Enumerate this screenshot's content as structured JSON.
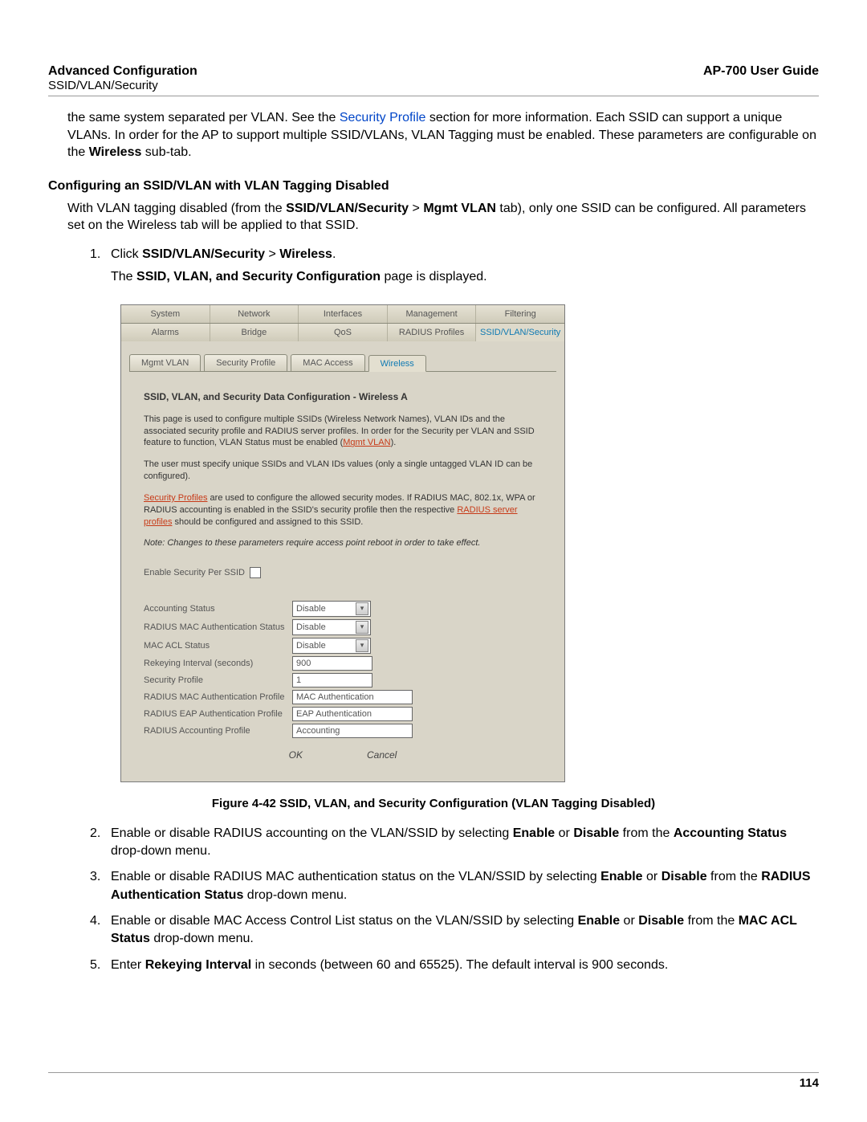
{
  "header": {
    "title": "Advanced Configuration",
    "subtitle": "SSID/VLAN/Security",
    "guide": "AP-700 User Guide"
  },
  "intro": {
    "p1a": "the same system separated per VLAN. See the ",
    "p1_link": "Security Profile",
    "p1b": " section for more information. Each SSID can support a unique VLANs. In order for the AP to support multiple SSID/VLANs, VLAN Tagging must be enabled. These parameters are configurable on the ",
    "p1_bold": "Wireless",
    "p1c": " sub-tab."
  },
  "section1": {
    "heading": "Configuring an SSID/VLAN with VLAN Tagging Disabled",
    "p1a": "With VLAN tagging disabled (from the ",
    "p1_bold1": "SSID/VLAN/Security",
    "p1_gt1": " > ",
    "p1_bold2": "Mgmt VLAN",
    "p1b": " tab), only one SSID can be configured. All parameters set on the Wireless tab will be applied to that SSID."
  },
  "step1": {
    "num": "1.",
    "a": "Click ",
    "b1": "SSID/VLAN/Security",
    "gt": " > ",
    "b2": "Wireless",
    "c": ".",
    "line2a": "The ",
    "line2b": "SSID, VLAN, and Security Configuration",
    "line2c": " page is displayed."
  },
  "shot": {
    "tabs1": [
      "System",
      "Network",
      "Interfaces",
      "Management",
      "Filtering"
    ],
    "tabs2": [
      "Alarms",
      "Bridge",
      "QoS",
      "RADIUS Profiles",
      "SSID/VLAN/Security"
    ],
    "subtabs": [
      "Mgmt VLAN",
      "Security Profile",
      "MAC Access",
      "Wireless"
    ],
    "active_tab2": 4,
    "active_subtab": 3,
    "title": "SSID, VLAN, and Security Data Configuration - Wireless A",
    "p1": "This page is used to configure multiple SSIDs (Wireless Network Names), VLAN IDs and the associated security profile and RADIUS server profiles. In order for the Security per VLAN and SSID feature to function, VLAN Status must be enabled (",
    "p1_link": "Mgmt VLAN",
    "p1_end": ").",
    "p2": "The user must specify unique SSIDs and VLAN IDs values (only a single untagged VLAN ID can be configured).",
    "p3_link": "Security Profiles",
    "p3": " are used to configure the allowed security modes. If RADIUS MAC, 802.1x, WPA or RADIUS accounting is enabled in the SSID's security profile then the respective ",
    "p3_link2": "RADIUS server profiles",
    "p3_end": " should be configured and assigned to this SSID.",
    "note": "Note: Changes to these parameters require access point reboot in order to take effect.",
    "chk_label": "Enable Security Per SSID",
    "rows": [
      {
        "label": "Accounting Status",
        "type": "select",
        "value": "Disable"
      },
      {
        "label": "RADIUS MAC Authentication Status",
        "type": "select",
        "value": "Disable"
      },
      {
        "label": "MAC ACL Status",
        "type": "select",
        "value": "Disable"
      },
      {
        "label": "Rekeying Interval (seconds)",
        "type": "input",
        "value": "900",
        "w": "w90"
      },
      {
        "label": "Security Profile",
        "type": "input",
        "value": "1",
        "w": "w90"
      },
      {
        "label": "RADIUS MAC Authentication Profile",
        "type": "input",
        "value": "MAC Authentication",
        "w": "w140"
      },
      {
        "label": "RADIUS EAP Authentication Profile",
        "type": "input",
        "value": "EAP Authentication",
        "w": "w140"
      },
      {
        "label": "RADIUS Accounting Profile",
        "type": "input",
        "value": "Accounting",
        "w": "w140"
      }
    ],
    "ok": "OK",
    "cancel": "Cancel"
  },
  "caption": "Figure 4-42 SSID, VLAN, and Security Configuration (VLAN Tagging Disabled)",
  "steps": [
    {
      "n": "2.",
      "a": "Enable or disable RADIUS accounting on the VLAN/SSID by selecting ",
      "b1": "Enable",
      "m1": " or ",
      "b2": "Disable",
      "m2": " from the ",
      "b3": "Accounting Status",
      "e": " drop-down menu."
    },
    {
      "n": "3.",
      "a": "Enable or disable RADIUS MAC authentication status on the VLAN/SSID by selecting ",
      "b1": "Enable",
      "m1": " or ",
      "b2": "Disable",
      "m2": " from the ",
      "b3": "RADIUS Authentication Status",
      "e": " drop-down menu."
    },
    {
      "n": "4.",
      "a": "Enable or disable MAC Access Control List status on the VLAN/SSID by selecting ",
      "b1": "Enable",
      "m1": " or ",
      "b2": "Disable",
      "m2": " from the ",
      "b3": "MAC ACL Status",
      "e": " drop-down menu."
    },
    {
      "n": "5.",
      "a": "Enter ",
      "b1": "Rekeying Interval",
      "m1": " in seconds (between 60 and 65525). The default interval is 900 seconds.",
      "b2": "",
      "m2": "",
      "b3": "",
      "e": ""
    }
  ],
  "page_number": "114"
}
